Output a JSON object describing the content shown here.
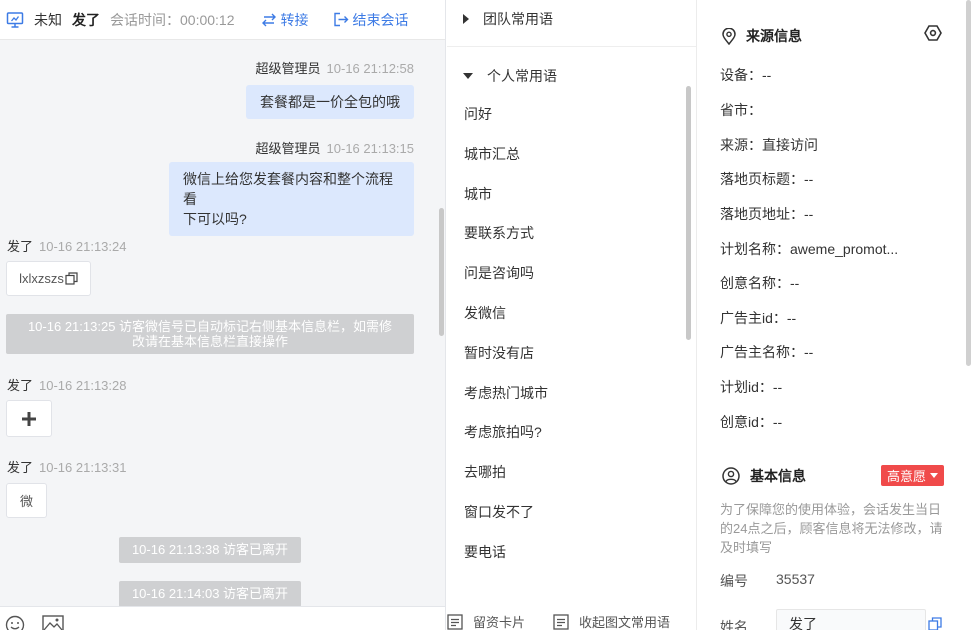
{
  "header": {
    "status": "未知",
    "visitor_name": "发了",
    "session_timer": "会话时间：00:00:12",
    "transfer_label": "转接",
    "end_label": "结束会话"
  },
  "messages": {
    "m1": {
      "sender": "超级管理员",
      "time": "10-16 21:12:58",
      "text": "套餐都是一价全包的哦"
    },
    "m2": {
      "sender": "超级管理员",
      "time": "10-16 21:13:15",
      "text_line1": "微信上给您发套餐内容和整个流程看",
      "text_line2": "下可以吗?"
    },
    "m3": {
      "sender": "发了",
      "time": "10-16 21:13:24",
      "text": "lxlxzszs"
    },
    "sys1": {
      "line1": "10-16 21:13:25 访客微信号已自动标记右侧基本信息栏，如需修",
      "line2": "改请在基本信息栏直接操作"
    },
    "m4": {
      "sender": "发了",
      "time": "10-16 21:13:28"
    },
    "m5": {
      "sender": "发了",
      "time": "10-16 21:13:31",
      "text": "微"
    },
    "sys2": "10-16 21:13:38 访客已离开",
    "sys3": "10-16 21:14:03 访客已离开"
  },
  "phrases": {
    "team_group": "团队常用语",
    "personal_group": "个人常用语",
    "items": [
      "问好",
      "城市汇总",
      "城市",
      "要联系方式",
      "问是咨询吗",
      "发微信",
      "暂时没有店",
      "考虑热门城市",
      "考虑旅拍吗?",
      "去哪拍",
      "窗口发不了",
      "要电话"
    ],
    "footer_card": "留资卡片",
    "footer_collapse": "收起图文常用语"
  },
  "source_info": {
    "title": "来源信息",
    "rows": [
      "设备：--",
      "省市：",
      "来源：直接访问",
      "落地页标题：--",
      "落地页地址：--",
      "计划名称：aweme_promot...",
      "创意名称：--",
      "广告主id：--",
      "广告主名称：--",
      "计划id：--",
      "创意id：--"
    ]
  },
  "basic_info": {
    "title": "基本信息",
    "intent_badge": "高意愿",
    "notice": "为了保障您的使用体验，会话发生当日的24点之后，顾客信息将无法修改，请及时填写",
    "id_label": "编号",
    "id_value": "35537",
    "name_label": "姓名",
    "name_value": "发了"
  },
  "colors": {
    "accent": "#3d7be5",
    "outgoing_bubble": "#dce8fd",
    "intent_badge": "#f04a4a",
    "system_notice": "#cfd0d2"
  }
}
